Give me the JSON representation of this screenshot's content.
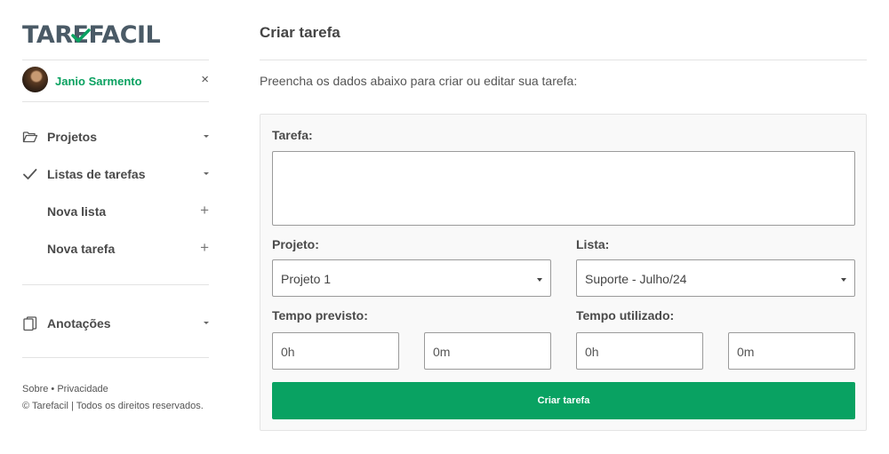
{
  "brand": {
    "name": "TAREFACIL",
    "accent": "#0aa160",
    "button_color": "#09a262"
  },
  "user": {
    "name": "Janio Sarmento",
    "close_symbol": "×"
  },
  "sidebar": {
    "items": [
      {
        "label": "Projetos",
        "icon": "folder-open-icon",
        "control": "caret"
      },
      {
        "label": "Listas de tarefas",
        "icon": "check-icon",
        "control": "caret"
      },
      {
        "label": "Nova lista",
        "control": "plus"
      },
      {
        "label": "Nova tarefa",
        "control": "plus"
      },
      {
        "label": "Anotações",
        "icon": "notes-icon",
        "control": "caret"
      }
    ],
    "plus_symbol": "+"
  },
  "footer": {
    "links": "Sobre • Privacidade",
    "copyright": "© Tarefacil | Todos os direitos reservados."
  },
  "main": {
    "title": "Criar tarefa",
    "intro": "Preencha os dados abaixo para criar ou editar sua tarefa:",
    "form": {
      "task_label": "Tarefa:",
      "task_value": "",
      "project_label": "Projeto:",
      "project_value": "Projeto 1",
      "list_label": "Lista:",
      "list_value": "Suporte - Julho/24",
      "planned_label": "Tempo previsto:",
      "planned_hours": "0h",
      "planned_minutes": "0m",
      "used_label": "Tempo utilizado:",
      "used_hours": "0h",
      "used_minutes": "0m",
      "submit_label": "Criar tarefa"
    }
  }
}
